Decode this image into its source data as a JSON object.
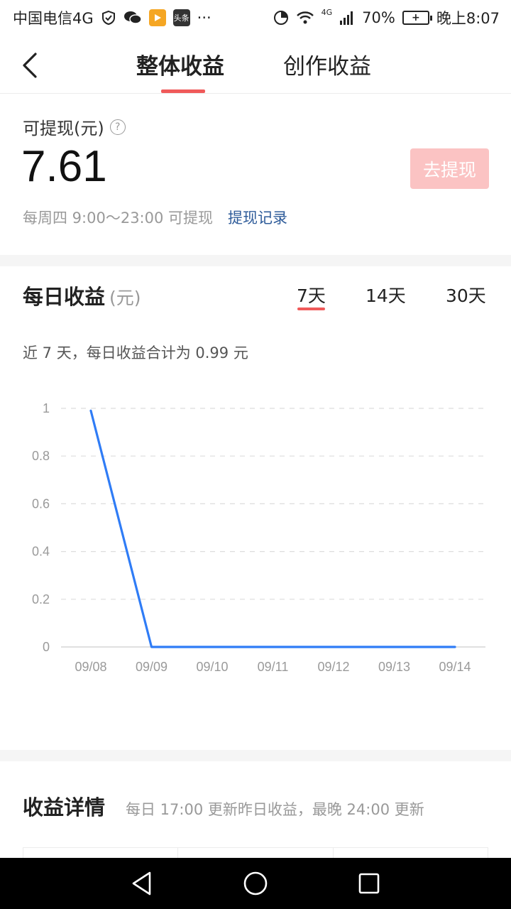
{
  "status_bar": {
    "carrier": "中国电信4G",
    "app_tile_label": "头条",
    "more": "···",
    "network": "4G",
    "battery": "70%",
    "time": "晚上8:07"
  },
  "header": {
    "tabs": [
      {
        "label": "整体收益",
        "active": true
      },
      {
        "label": "创作收益",
        "active": false
      }
    ]
  },
  "balance": {
    "label": "可提现(元)",
    "help_glyph": "?",
    "value": "7.61",
    "withdraw_button": "去提现",
    "schedule": "每周四 9:00～23:00 可提现",
    "record_link": "提现记录"
  },
  "daily": {
    "title": "每日收益",
    "unit": "(元)",
    "ranges": [
      {
        "label": "7天",
        "active": true
      },
      {
        "label": "14天",
        "active": false
      },
      {
        "label": "30天",
        "active": false
      }
    ],
    "summary": "近 7 天，每日收益合计为 0.99 元"
  },
  "chart_data": {
    "type": "line",
    "x": [
      "09/08",
      "09/09",
      "09/10",
      "09/11",
      "09/12",
      "09/13",
      "09/14"
    ],
    "y_ticks": [
      "1",
      "0.8",
      "0.6",
      "0.4",
      "0.2",
      "0"
    ],
    "ylim": [
      0,
      1
    ],
    "grid": true,
    "series": [
      {
        "values": [
          0.99,
          0,
          0,
          0,
          0,
          0,
          0
        ],
        "color": "#2f7cf6"
      }
    ]
  },
  "details": {
    "title": "收益详情",
    "note": "每日 17:00 更新昨日收益，最晚 24:00 更新"
  },
  "colors": {
    "accent": "#f05a5a",
    "line": "#2f7cf6",
    "link": "#2f5c9a",
    "button_disabled": "#fbc3c3"
  }
}
